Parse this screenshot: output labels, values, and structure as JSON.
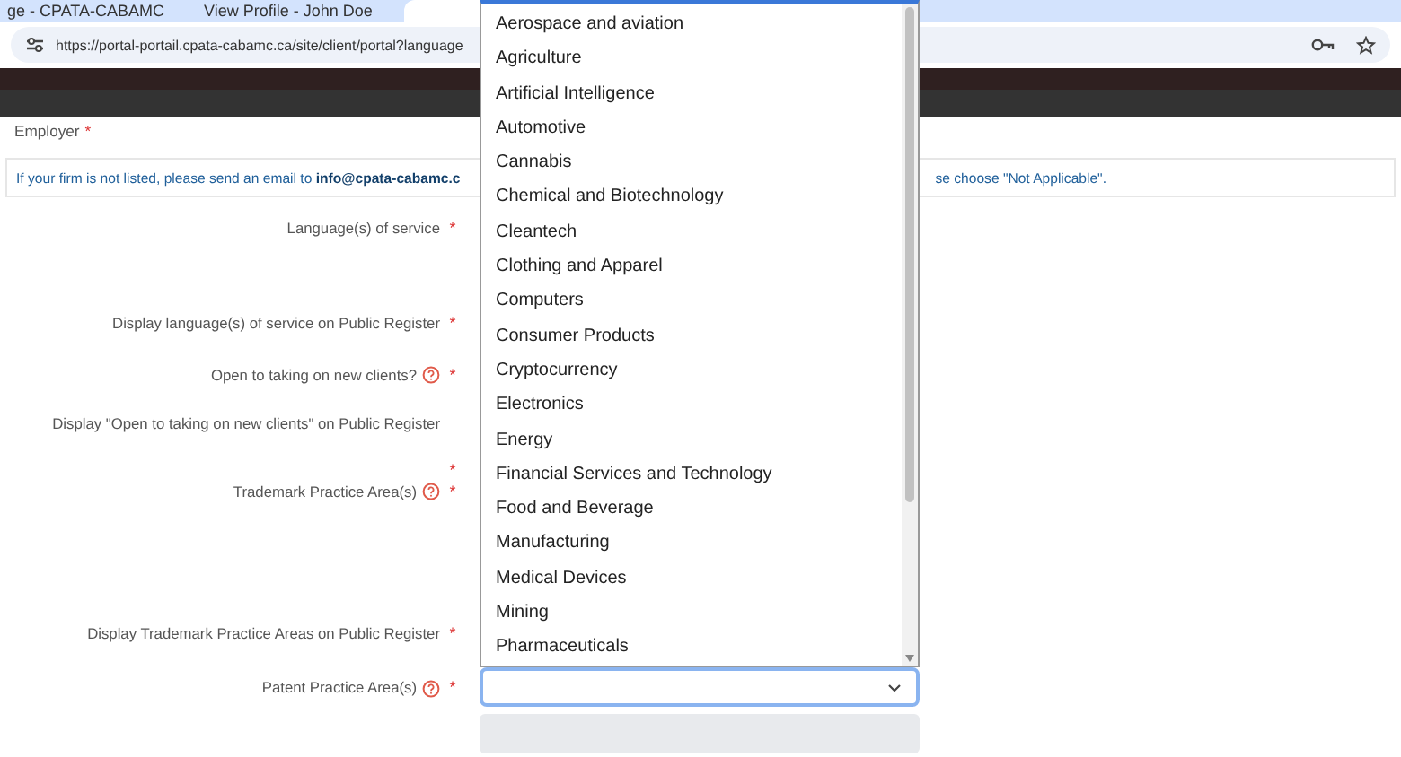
{
  "browser": {
    "tabs": [
      {
        "title": "ge - CPATA-CABAMC",
        "selected": false
      },
      {
        "title": "View Profile - John Doe",
        "selected": false
      },
      {
        "selected": true
      }
    ],
    "url": "https://portal-portail.cpata-cabamc.ca/site/client/portal?language"
  },
  "form": {
    "employer_label": "Employer",
    "employer_mark": "*",
    "info_text": "If your firm is not listed, please send an email to **info@cpata-cabamc.c**",
    "info_text_end": "se choose \"Not Applicable\".",
    "fields": [
      {
        "label": "Language(s) of service",
        "help": false,
        "required_mark": "*"
      },
      {
        "label": "Display language(s) of service on Public Register",
        "help": false,
        "required_mark": "*"
      },
      {
        "label": "Open to taking on new clients?",
        "help": true,
        "required_mark": "*"
      },
      {
        "label": "Display \"Open to taking on new clients\" on Public Register",
        "help": false,
        "required_mark": "*"
      },
      {
        "label": "Trademark Practice Area(s)",
        "help": true,
        "required_mark": "*"
      },
      {
        "label": "Display Trademark Practice Areas on Public Register",
        "help": false,
        "required_mark": "*"
      },
      {
        "label": "Patent Practice Area(s)",
        "help": true,
        "required_mark": "*"
      }
    ]
  },
  "dropdown": {
    "options": [
      "Aerospace and aviation",
      "Agriculture",
      "Artificial Intelligence",
      "Automotive",
      "Cannabis",
      "Chemical and Biotechnology",
      "Cleantech",
      "Clothing and Apparel",
      "Computers",
      "Consumer Products",
      "Cryptocurrency",
      "Electronics",
      "Energy",
      "Financial Services and Technology",
      "Food and Beverage",
      "Manufacturing",
      "Medical Devices",
      "Mining",
      "Pharmaceuticals"
    ]
  }
}
